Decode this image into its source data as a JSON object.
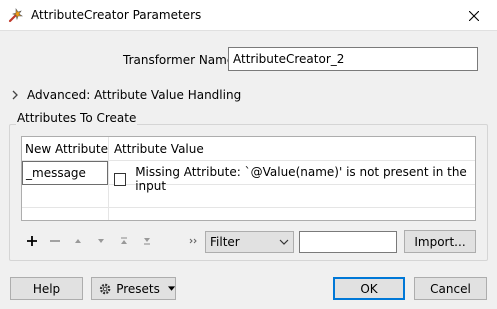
{
  "window": {
    "title": "AttributeCreator Parameters",
    "app_icon": "fme-transformer-icon",
    "close_icon": "close-icon"
  },
  "transformer_name": {
    "label": "Transformer Name:",
    "value": "AttributeCreator_2"
  },
  "advanced": {
    "label": "Advanced: Attribute Value Handling",
    "expanded": false
  },
  "attributes_group": {
    "title": "Attributes To Create",
    "columns": [
      "New Attribute",
      "Attribute Value"
    ],
    "rows": [
      {
        "name": "_message",
        "checked": false,
        "value": "Missing Attribute: `@Value(name)' is not present in the input"
      }
    ]
  },
  "toolbar": {
    "icons": [
      "add-icon",
      "remove-icon",
      "move-up-icon",
      "move-down-icon",
      "move-top-icon",
      "move-bottom-icon",
      "expand-more-icon"
    ],
    "filter_select": "Filter",
    "filter_value": "",
    "import_label": "Import..."
  },
  "footer": {
    "help": "Help",
    "presets": "Presets",
    "ok": "OK",
    "cancel": "Cancel"
  },
  "colors": {
    "accent": "#0078d7",
    "background": "#f0f0f0"
  }
}
